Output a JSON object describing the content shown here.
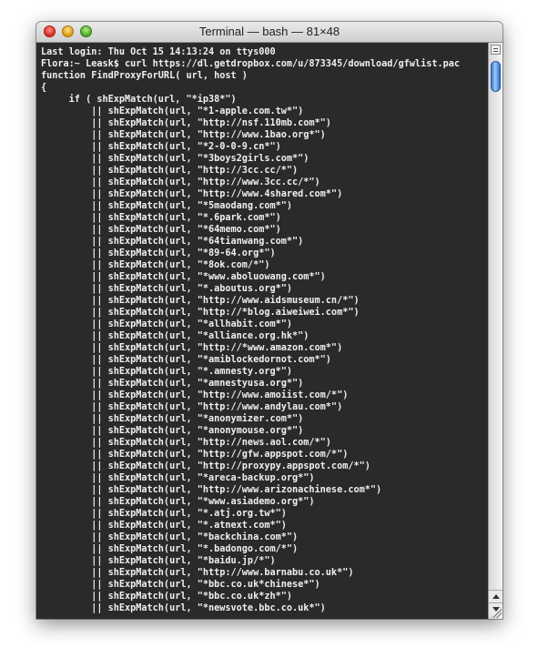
{
  "window": {
    "title": "Terminal — bash — 81×48"
  },
  "terminal": {
    "lines": [
      "Last login: Thu Oct 15 14:13:24 on ttys000",
      "Flora:~ Leask$ curl https://dl.getdropbox.com/u/873345/download/gfwlist.pac",
      "function FindProxyForURL( url, host )",
      "{",
      "     if ( shExpMatch(url, \"*ip38*\")",
      "         || shExpMatch(url, \"*1-apple.com.tw*\")",
      "         || shExpMatch(url, \"http://nsf.110mb.com*\")",
      "         || shExpMatch(url, \"http://www.1bao.org*\")",
      "         || shExpMatch(url, \"*2-0-0-9.cn*\")",
      "         || shExpMatch(url, \"*3boys2girls.com*\")",
      "         || shExpMatch(url, \"http://3cc.cc/*\")",
      "         || shExpMatch(url, \"http://www.3cc.cc/*\")",
      "         || shExpMatch(url, \"http://www.4shared.com*\")",
      "         || shExpMatch(url, \"*5maodang.com*\")",
      "         || shExpMatch(url, \"*.6park.com*\")",
      "         || shExpMatch(url, \"*64memo.com*\")",
      "         || shExpMatch(url, \"*64tianwang.com*\")",
      "         || shExpMatch(url, \"*89-64.org*\")",
      "         || shExpMatch(url, \"*8ok.com/*\")",
      "         || shExpMatch(url, \"*www.aboluowang.com*\")",
      "         || shExpMatch(url, \"*.aboutus.org*\")",
      "         || shExpMatch(url, \"http://www.aidsmuseum.cn/*\")",
      "         || shExpMatch(url, \"http://*blog.aiweiwei.com*\")",
      "         || shExpMatch(url, \"*allhabit.com*\")",
      "         || shExpMatch(url, \"*alliance.org.hk*\")",
      "         || shExpMatch(url, \"http://*www.amazon.com*\")",
      "         || shExpMatch(url, \"*amiblockedornot.com*\")",
      "         || shExpMatch(url, \"*.amnesty.org*\")",
      "         || shExpMatch(url, \"*amnestyusa.org*\")",
      "         || shExpMatch(url, \"http://www.amoiist.com/*\")",
      "         || shExpMatch(url, \"http://www.andylau.com*\")",
      "         || shExpMatch(url, \"*anonymizer.com*\")",
      "         || shExpMatch(url, \"*anonymouse.org*\")",
      "         || shExpMatch(url, \"http://news.aol.com/*\")",
      "         || shExpMatch(url, \"http://gfw.appspot.com/*\")",
      "         || shExpMatch(url, \"http://proxypy.appspot.com/*\")",
      "         || shExpMatch(url, \"*areca-backup.org*\")",
      "         || shExpMatch(url, \"http://www.arizonachinese.com*\")",
      "         || shExpMatch(url, \"*www.asiademo.org*\")",
      "         || shExpMatch(url, \"*.atj.org.tw*\")",
      "         || shExpMatch(url, \"*.atnext.com*\")",
      "         || shExpMatch(url, \"*backchina.com*\")",
      "         || shExpMatch(url, \"*.badongo.com/*\")",
      "         || shExpMatch(url, \"*baidu.jp/*\")",
      "         || shExpMatch(url, \"http://www.barnabu.co.uk*\")",
      "         || shExpMatch(url, \"*bbc.co.uk*chinese*\")",
      "         || shExpMatch(url, \"*bbc.co.uk*zh*\")",
      "         || shExpMatch(url, \"*newsvote.bbc.co.uk*\")"
    ]
  },
  "icons": {
    "close": "close-icon",
    "minimize": "minimize-icon",
    "zoom": "zoom-icon",
    "split": "split-view-icon",
    "scroll_up": "arrow-up-icon",
    "scroll_down": "arrow-down-icon",
    "resize": "resize-grip-icon"
  },
  "colors": {
    "terminal_background": "#2a2a2a",
    "terminal_text": "#f0f0f0",
    "scroll_thumb": "#3d7fd6"
  }
}
